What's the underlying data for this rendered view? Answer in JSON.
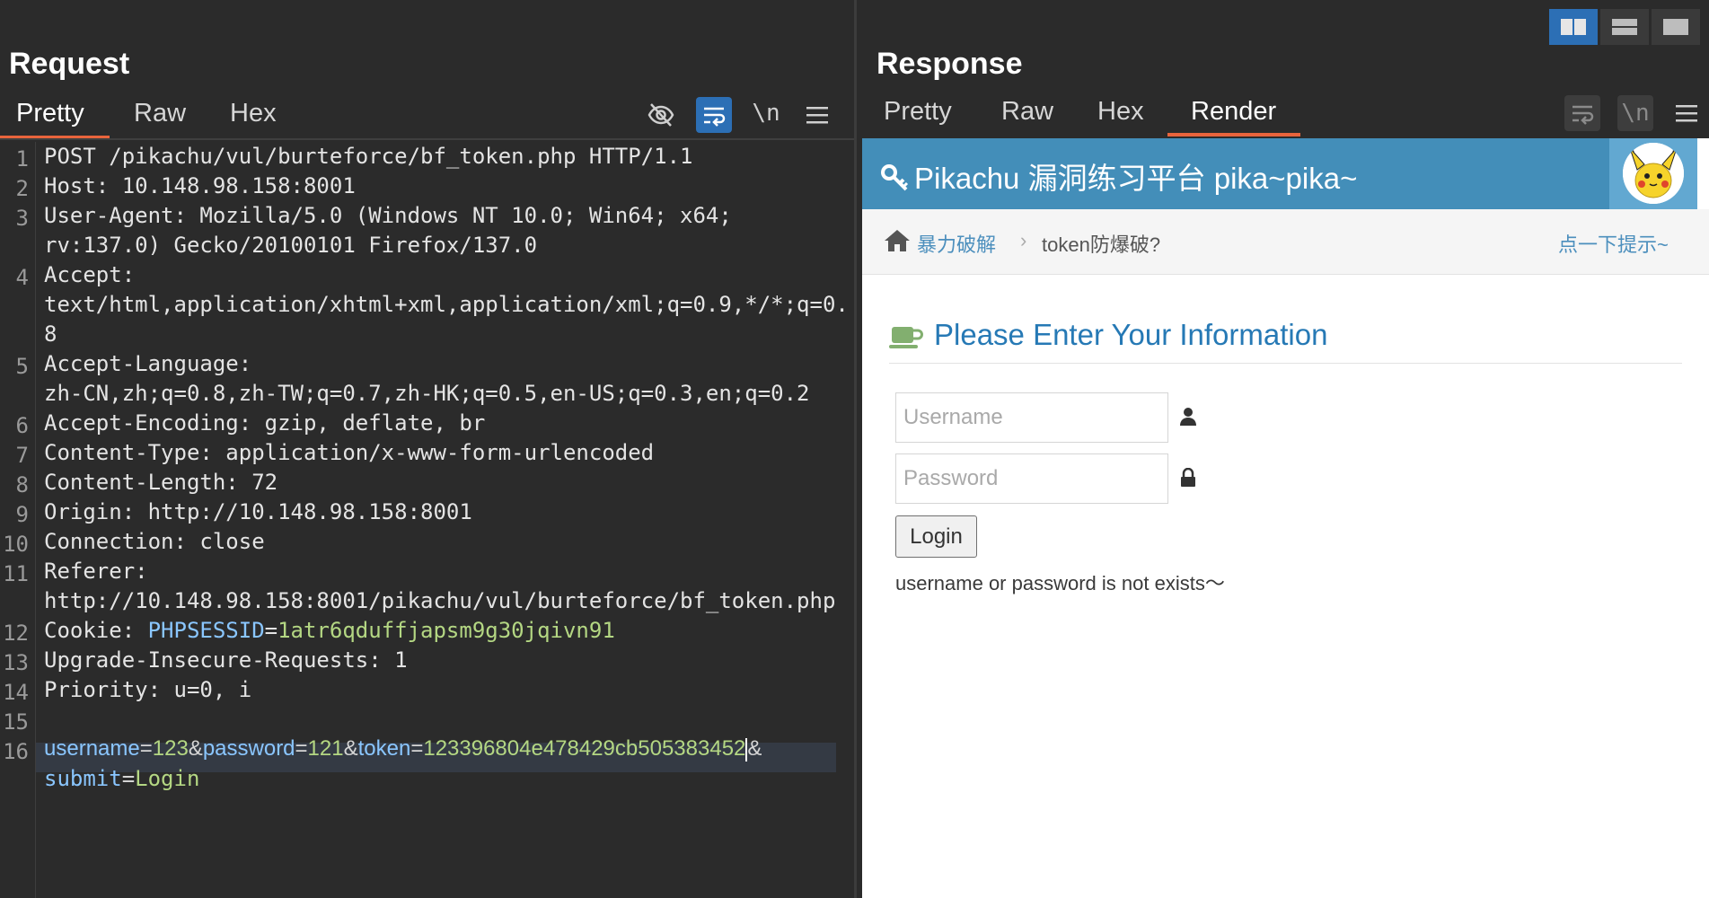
{
  "request": {
    "title": "Request",
    "tabs": [
      "Pretty",
      "Raw",
      "Hex"
    ],
    "active_tab": "Pretty",
    "tools": {
      "hide_icon": "eye-off-icon",
      "wrap_icon": "wrap-lines-icon",
      "newline_label": "\\n",
      "menu_icon": "hamburger-menu-icon"
    },
    "lines": [
      {
        "num": "1",
        "key": "POST /pikachu/vul/burteforce/bf_token.php HTTP/1.1"
      },
      {
        "num": "2",
        "key": "Host: 10.148.98.158:8001"
      },
      {
        "num": "3",
        "key": "User-Agent: Mozilla/5.0 (Windows NT 10.0; Win64; x64;",
        "cont": [
          "rv:137.0) Gecko/20100101 Firefox/137.0"
        ]
      },
      {
        "num": "4",
        "key": "Accept:",
        "cont": [
          "text/html,application/xhtml+xml,application/xml;q=0.9,*/*;q=0.",
          "8"
        ]
      },
      {
        "num": "5",
        "key": "Accept-Language:",
        "cont": [
          "zh-CN,zh;q=0.8,zh-TW;q=0.7,zh-HK;q=0.5,en-US;q=0.3,en;q=0.2"
        ]
      },
      {
        "num": "6",
        "key": "Accept-Encoding: gzip, deflate, br"
      },
      {
        "num": "7",
        "key": "Content-Type: application/x-www-form-urlencoded"
      },
      {
        "num": "8",
        "key": "Content-Length: 72"
      },
      {
        "num": "9",
        "key": "Origin: http://10.148.98.158:8001"
      },
      {
        "num": "10",
        "key": "Connection: close"
      },
      {
        "num": "11",
        "key": "Referer:",
        "cont": [
          "http://10.148.98.158:8001/pikachu/vul/burteforce/bf_token.php"
        ]
      },
      {
        "num": "12",
        "cookie_name": "Cookie: ",
        "cookie_key": "PHPSESSID",
        "cookie_eq": "=",
        "cookie_val": "1atr6qduffjapsm9g30jqivn91"
      },
      {
        "num": "13",
        "key": "Upgrade-Insecure-Requests: 1"
      },
      {
        "num": "14",
        "key": "Priority: u=0, i"
      },
      {
        "num": "15",
        "key": ""
      },
      {
        "num": "16",
        "body": [
          {
            "k": "username",
            "v": "123"
          },
          {
            "k": "password",
            "v": "121"
          },
          {
            "k": "token",
            "v": "123396804e478429cb505383452"
          }
        ],
        "body_tail": "&",
        "body2_k": "submit",
        "body2_v": "Login"
      }
    ]
  },
  "response": {
    "title": "Response",
    "tabs": [
      "Pretty",
      "Raw",
      "Hex",
      "Render"
    ],
    "active_tab": "Render",
    "tools": {
      "wrap_icon": "wrap-lines-icon",
      "newline_label": "\\n",
      "menu_icon": "hamburger-menu-icon"
    },
    "render": {
      "site_title": "Pikachu 漏洞练习平台 pika~pika~",
      "breadcrumb_home": "暴力破解",
      "breadcrumb_current": "token防爆破?",
      "hint_link": "点一下提示~",
      "section_title": "Please Enter Your Information",
      "username_placeholder": "Username",
      "password_placeholder": "Password",
      "login_label": "Login",
      "message": "username or password is not exists～"
    }
  },
  "layout_buttons": [
    "split-horizontal-icon",
    "split-vertical-icon",
    "single-pane-icon"
  ],
  "colors": {
    "accent": "#e8643c",
    "toolbar_active": "#2c6fb5",
    "value_green": "#b4d783",
    "pikachu_blue": "#438eb9"
  }
}
